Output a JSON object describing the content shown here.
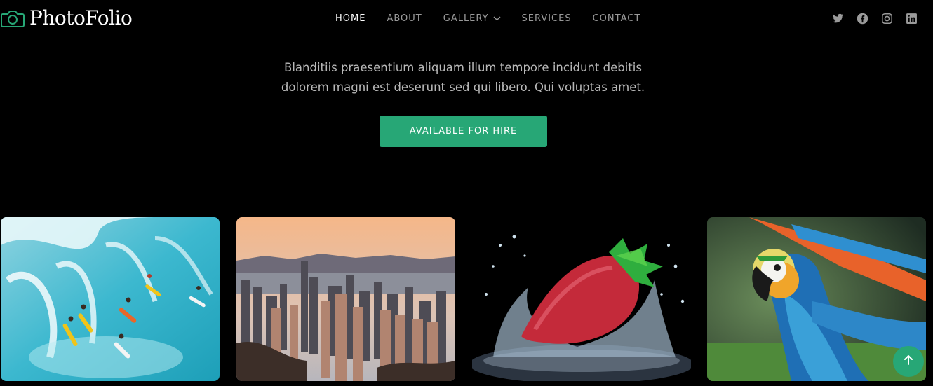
{
  "brand": {
    "name": "PhotoFolio",
    "icon": "camera-icon",
    "accent": "#27a776"
  },
  "nav": {
    "items": [
      {
        "label": "HOME",
        "active": true
      },
      {
        "label": "ABOUT"
      },
      {
        "label": "GALLERY",
        "dropdown": true
      },
      {
        "label": "SERVICES"
      },
      {
        "label": "CONTACT"
      }
    ]
  },
  "social": [
    "twitter-icon",
    "facebook-icon",
    "instagram-icon",
    "linkedin-icon"
  ],
  "hero": {
    "line1": "Blanditiis praesentium aliquam illum tempore incidunt debitis",
    "line2": "dolorem magni est deserunt sed qui libero. Qui voluptas amet.",
    "cta": "AVAILABLE FOR HIRE"
  },
  "gallery": {
    "items": [
      "surfers-photo",
      "city-skyline-photo",
      "strawberry-splash-photo",
      "parrot-photo"
    ]
  },
  "scroll_top": {
    "icon": "arrow-up-icon"
  }
}
